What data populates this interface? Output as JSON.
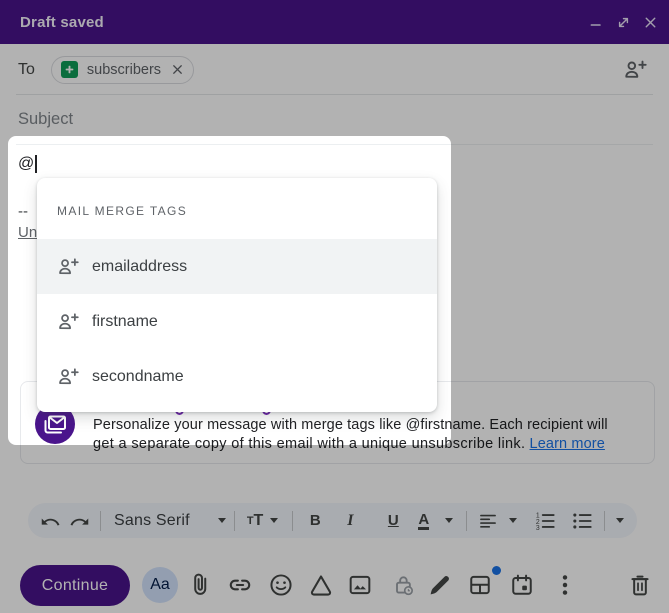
{
  "header": {
    "title": "Draft saved"
  },
  "to_row": {
    "label": "To",
    "chip_label": "subscribers"
  },
  "subject": {
    "placeholder": "Subject"
  },
  "body": {
    "typed": "@",
    "signature_dashes": "--",
    "unsubscribe_link": "Unsubscribe"
  },
  "dropdown": {
    "header": "MAIL MERGE TAGS",
    "items": [
      {
        "label": "emailaddress"
      },
      {
        "label": "firstname"
      },
      {
        "label": "secondname"
      }
    ]
  },
  "banner": {
    "line1": "Personalize your message with merge tags like @firstname. Each recipient will",
    "line2": "get a separate copy of this email with a unique unsubscribe link.",
    "link": "Learn more"
  },
  "toolbar": {
    "font_name": "Sans Serif",
    "bold": "B",
    "italic": "I",
    "underline": "U",
    "color_letter": "A",
    "size_small": "T",
    "size_large": "T"
  },
  "footer": {
    "continue_label": "Continue",
    "text_style_label": "Aa"
  },
  "colors": {
    "titlebar": "#4a148c",
    "accent_blue": "#1a73e8",
    "sheets_green": "#0f9d58",
    "selected_row": "#f1f3f4",
    "dim_overlay": "rgba(0,0,0,0.3)"
  }
}
